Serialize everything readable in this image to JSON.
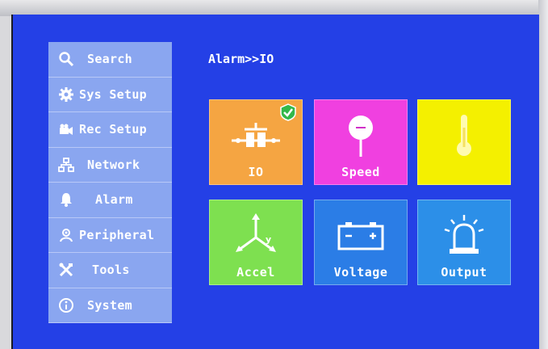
{
  "breadcrumb": "Alarm>>IO",
  "sidebar": {
    "items": [
      {
        "label": "Search",
        "icon": "search-icon"
      },
      {
        "label": "Sys Setup",
        "icon": "gear-icon"
      },
      {
        "label": "Rec Setup",
        "icon": "camera-icon"
      },
      {
        "label": "Network",
        "icon": "network-icon"
      },
      {
        "label": "Alarm",
        "icon": "bell-icon"
      },
      {
        "label": "Peripheral",
        "icon": "peripheral-icon"
      },
      {
        "label": "Tools",
        "icon": "tools-icon"
      },
      {
        "label": "System",
        "icon": "info-icon"
      }
    ]
  },
  "tiles": [
    {
      "label": "IO",
      "icon": "io-switch-icon",
      "color": "#f5a542",
      "selected": true
    },
    {
      "label": "Speed",
      "icon": "speed-pin-icon",
      "color": "#f040e0"
    },
    {
      "label": "",
      "icon": "thermometer-icon",
      "color": "#f4f000"
    },
    {
      "label": "Accel",
      "icon": "accel-axes-icon",
      "color": "#7ee050"
    },
    {
      "label": "Voltage",
      "icon": "battery-icon",
      "color": "#2b7de6"
    },
    {
      "label": "Output",
      "icon": "siren-icon",
      "color": "#2c8fe8"
    }
  ],
  "colors": {
    "screen_bg": "#2440e6",
    "sidebar_bg": "#8aa6f0",
    "text": "#ffffff",
    "check": "#33b84a"
  }
}
